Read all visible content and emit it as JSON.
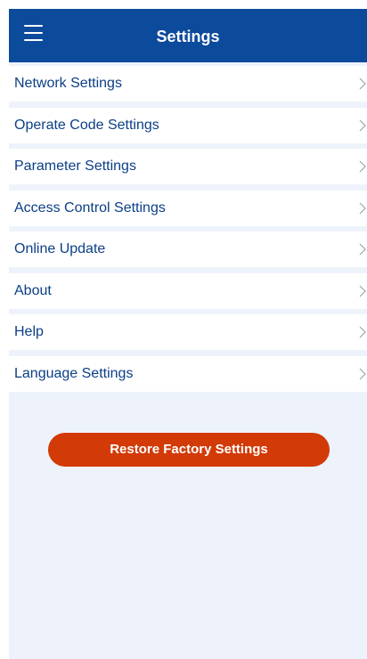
{
  "header": {
    "title": "Settings",
    "menu_icon": "hamburger-menu-icon",
    "background": "#0c4a9c"
  },
  "menu": {
    "items": [
      {
        "label": "Network Settings"
      },
      {
        "label": "Operate Code Settings"
      },
      {
        "label": "Parameter Settings"
      },
      {
        "label": "Access Control Settings"
      },
      {
        "label": "Online Update"
      },
      {
        "label": "About"
      },
      {
        "label": "Help"
      },
      {
        "label": "Language Settings"
      }
    ],
    "chevron_icon": "chevron-right-icon",
    "label_color": "#0c3f86"
  },
  "actions": {
    "restore_label": "Restore Factory Settings",
    "restore_color": "#d23a07"
  }
}
